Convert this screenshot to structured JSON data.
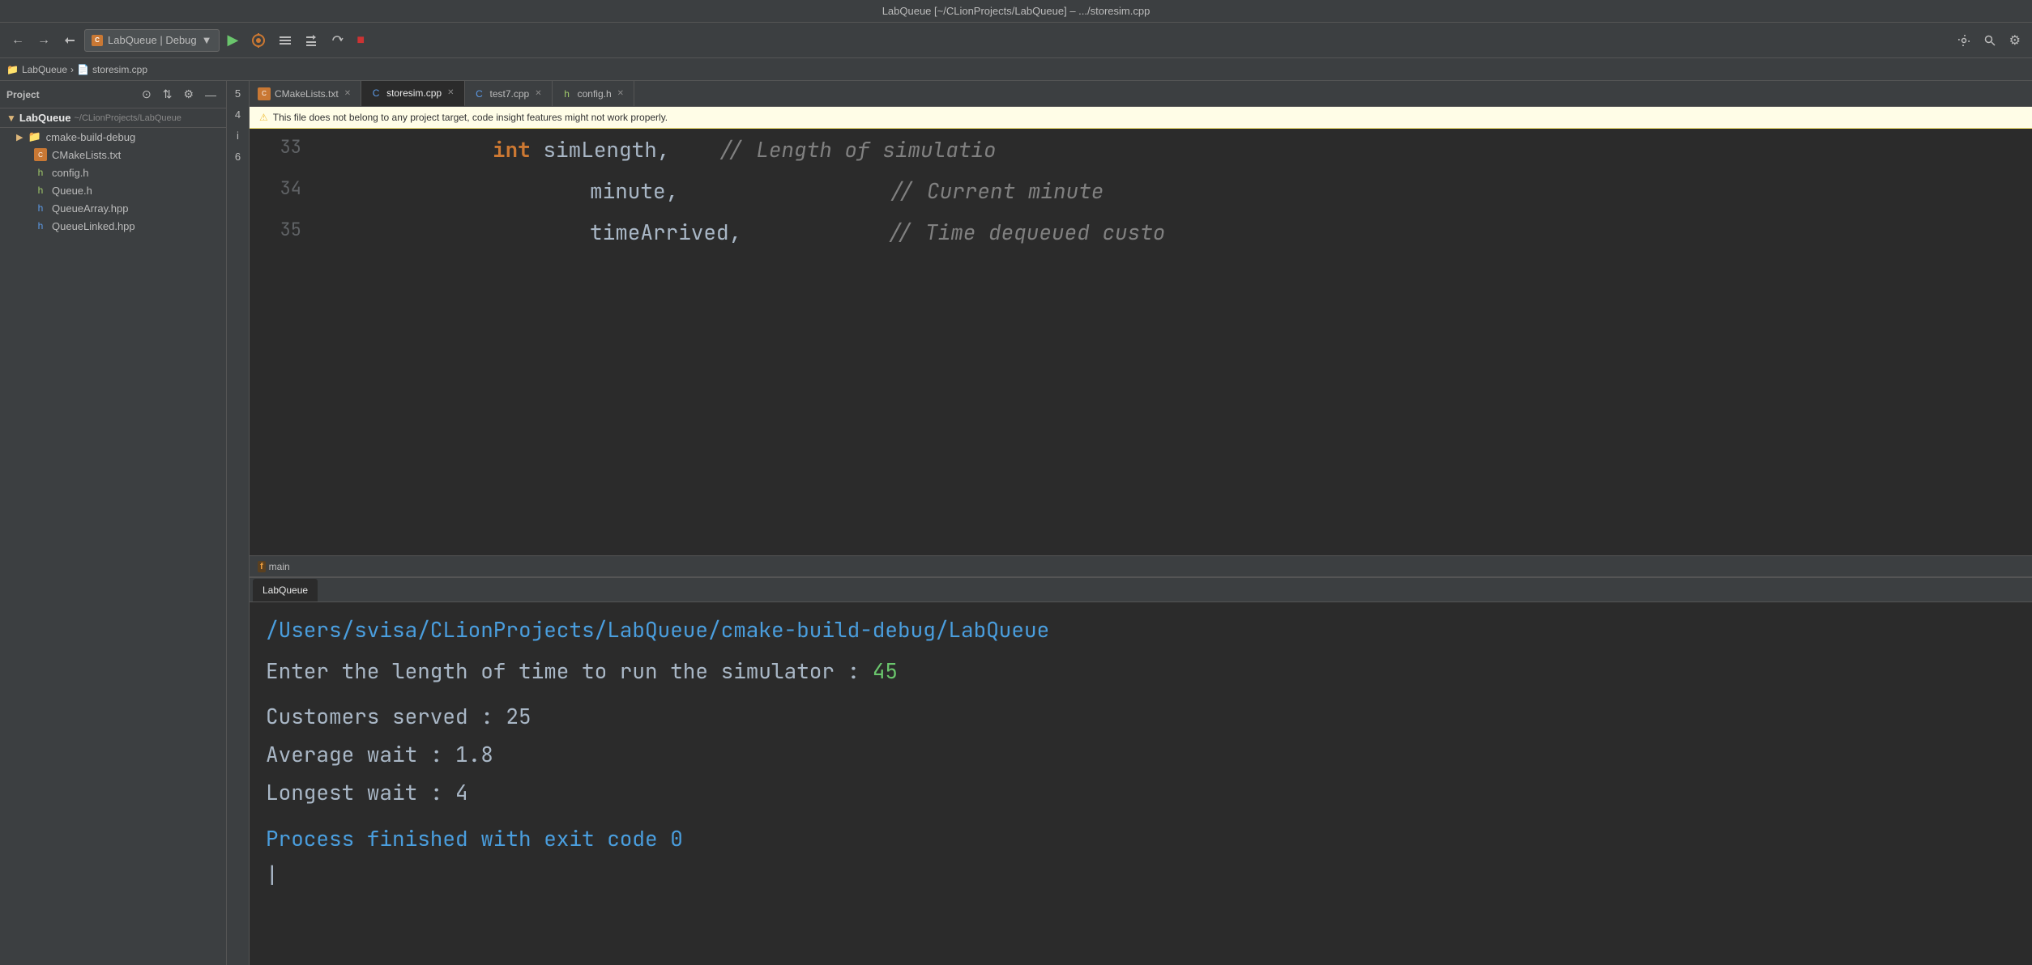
{
  "window": {
    "title": "LabQueue [~/CLionProjects/LabQueue] – .../storesim.cpp"
  },
  "toolbar": {
    "back_label": "←",
    "forward_label": "→",
    "config_label": "LabQueue | Debug",
    "run_label": "▶",
    "debug_label": "🐛",
    "build_label": "⚙",
    "stop_label": "■",
    "settings_label": "🔧",
    "search_label": "🔍",
    "more_label": "⋮"
  },
  "breadcrumb": {
    "project": "LabQueue",
    "separator": "›",
    "file": "storesim.cpp",
    "icon": "📄"
  },
  "sidebar": {
    "header": "Project",
    "root_label": "LabQueue",
    "root_path": "~/CLionProjects/LabQueue",
    "items": [
      {
        "name": "cmake-build-debug",
        "type": "folder"
      },
      {
        "name": "CMakeLists.txt",
        "type": "cmake"
      },
      {
        "name": "config.h",
        "type": "h"
      },
      {
        "name": "Queue.h",
        "type": "h"
      },
      {
        "name": "QueueArray.hpp",
        "type": "hpp"
      },
      {
        "name": "QueueLinked.hpp",
        "type": "hpp"
      }
    ]
  },
  "editor": {
    "tabs": [
      {
        "label": "CMakeLists.txt",
        "type": "cmake",
        "active": false
      },
      {
        "label": "storesim.cpp",
        "type": "cpp",
        "active": true
      },
      {
        "label": "test7.cpp",
        "type": "cpp",
        "active": false
      },
      {
        "label": "config.h",
        "type": "h",
        "active": false
      }
    ],
    "warning": "This file does not belong to any project target, code insight features might not work properly.",
    "lines": [
      {
        "number": "33",
        "indent": "            ",
        "keyword": "int",
        "rest": " simLength,",
        "comment": "// Length of simulatio"
      },
      {
        "number": "34",
        "indent": "            ",
        "keyword": "",
        "rest": "minute,",
        "comment": "// Current minute"
      },
      {
        "number": "35",
        "indent": "            ",
        "keyword": "",
        "rest": "timeArrived,",
        "comment": "// Time dequeued custo"
      }
    ],
    "function_breadcrumb": "f  main"
  },
  "run_panel": {
    "tabs": [
      "LabQueue"
    ],
    "path": "/Users/svisa/CLionProjects/LabQueue/cmake-build-debug/LabQueue",
    "prompt_line": "Enter the length of time to run the simulator : ",
    "prompt_value": "45",
    "stats": [
      {
        "label": "Customers served",
        "separator": ": ",
        "value": "25"
      },
      {
        "label": "Average wait    ",
        "separator": ": ",
        "value": "1.8"
      },
      {
        "label": "Longest wait    ",
        "separator": ": ",
        "value": "4"
      }
    ],
    "exit_message": "Process finished with exit code 0",
    "cursor": "|"
  }
}
